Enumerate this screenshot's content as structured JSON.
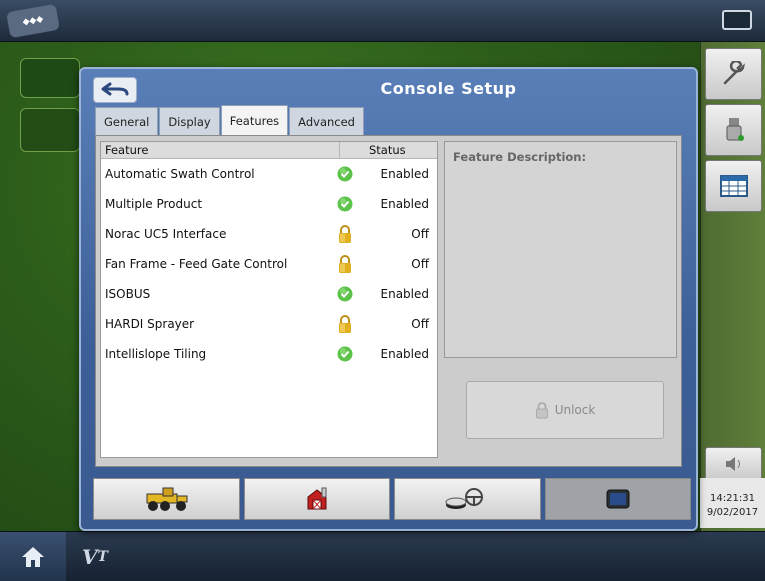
{
  "dialog": {
    "title": "Console Setup",
    "tabs": [
      {
        "label": "General"
      },
      {
        "label": "Display"
      },
      {
        "label": "Features"
      },
      {
        "label": "Advanced"
      }
    ],
    "active_tab": "Features"
  },
  "features": {
    "header_feature": "Feature",
    "header_status": "Status",
    "rows": [
      {
        "name": "Automatic Swath Control",
        "status": "Enabled",
        "icon": "check-icon"
      },
      {
        "name": "Multiple Product",
        "status": "Enabled",
        "icon": "check-icon"
      },
      {
        "name": "Norac UC5 Interface",
        "status": "Off",
        "icon": "lock-icon"
      },
      {
        "name": "Fan Frame - Feed Gate Control",
        "status": "Off",
        "icon": "lock-icon"
      },
      {
        "name": "ISOBUS",
        "status": "Enabled",
        "icon": "check-icon"
      },
      {
        "name": "HARDI Sprayer",
        "status": "Off",
        "icon": "lock-icon"
      },
      {
        "name": "Intellislope Tiling",
        "status": "Enabled",
        "icon": "check-icon"
      }
    ]
  },
  "description": {
    "label": "Feature Description:"
  },
  "unlock": {
    "label": "Unlock"
  },
  "status_clock": {
    "time": "14:21:31",
    "date": "9/02/2017"
  },
  "colors": {
    "enabled_green": "#5cc24a",
    "lock_gold": "#e0b020",
    "dialog_blue": "#4a6ea8"
  }
}
